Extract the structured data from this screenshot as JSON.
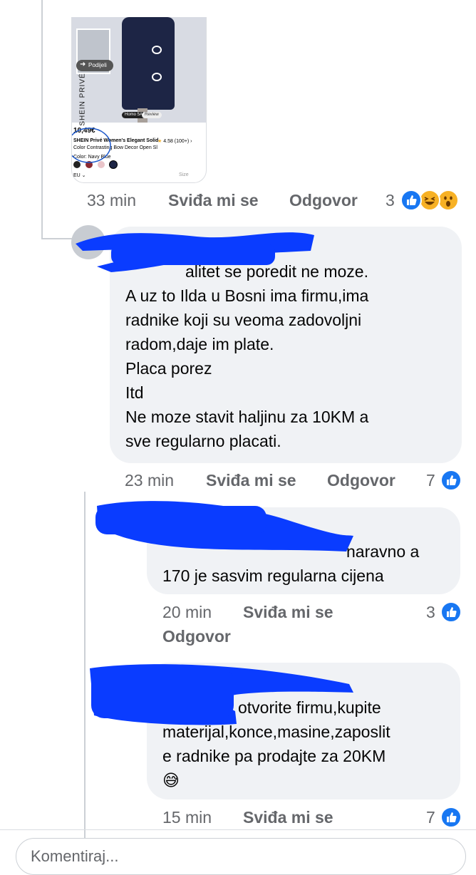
{
  "product_card": {
    "share_label": "Podijeli",
    "brand_vertical": "SHEIN PRIVÉ",
    "tag_label": "Homo 5A",
    "review_label": "Review",
    "price": "10,49€",
    "rating": "4.58 (100+)",
    "title_line1": "SHEIN Privé Women's Elegant Solid",
    "title_line2": "Color Contrasting Bow Decor Open Sl",
    "color_label": "Color: Navy Blue",
    "size_label": "EU",
    "size_button": "Size"
  },
  "comments": [
    {
      "time": "33 min",
      "like_label": "Sviđa mi se",
      "reply_label": "Odgovor",
      "reaction_count": "3"
    },
    {
      "lines": [
        "alitet se poredit ne moze.",
        "A uz to Ilda u Bosni ima firmu,ima",
        "radnike koji su veoma zadovoljni",
        "radom,daje im plate.",
        "Placa porez",
        "Itd",
        "Ne moze stavit haljinu za 10KM a",
        "sve regularno placati."
      ],
      "time": "23 min",
      "like_label": "Sviđa mi se",
      "reply_label": "Odgovor",
      "reaction_count": "7"
    },
    {
      "lines": [
        "naravno a",
        "170 je sasvim regularna cijena"
      ],
      "time": "20 min",
      "like_label": "Sviđa mi se",
      "reply_label": "Odgovor",
      "reaction_count": "3"
    },
    {
      "lines": [
        "otvorite firmu,kupite",
        "materijal,konce,masine,zaposlit",
        "e radnike pa prodajte za 20KM",
        "😅"
      ],
      "time": "15 min",
      "like_label": "Sviđa mi se",
      "reaction_count": "7"
    }
  ],
  "comment_input": {
    "placeholder": "Komentiraj..."
  },
  "colors": {
    "like_blue": "#1877f2",
    "redaction_blue": "#0a3cff",
    "bubble_bg": "#f0f2f5",
    "meta_text": "#65676b"
  },
  "icons": [
    "share-icon",
    "like-icon",
    "haha-icon",
    "wow-icon",
    "thumbs-up-icon"
  ]
}
